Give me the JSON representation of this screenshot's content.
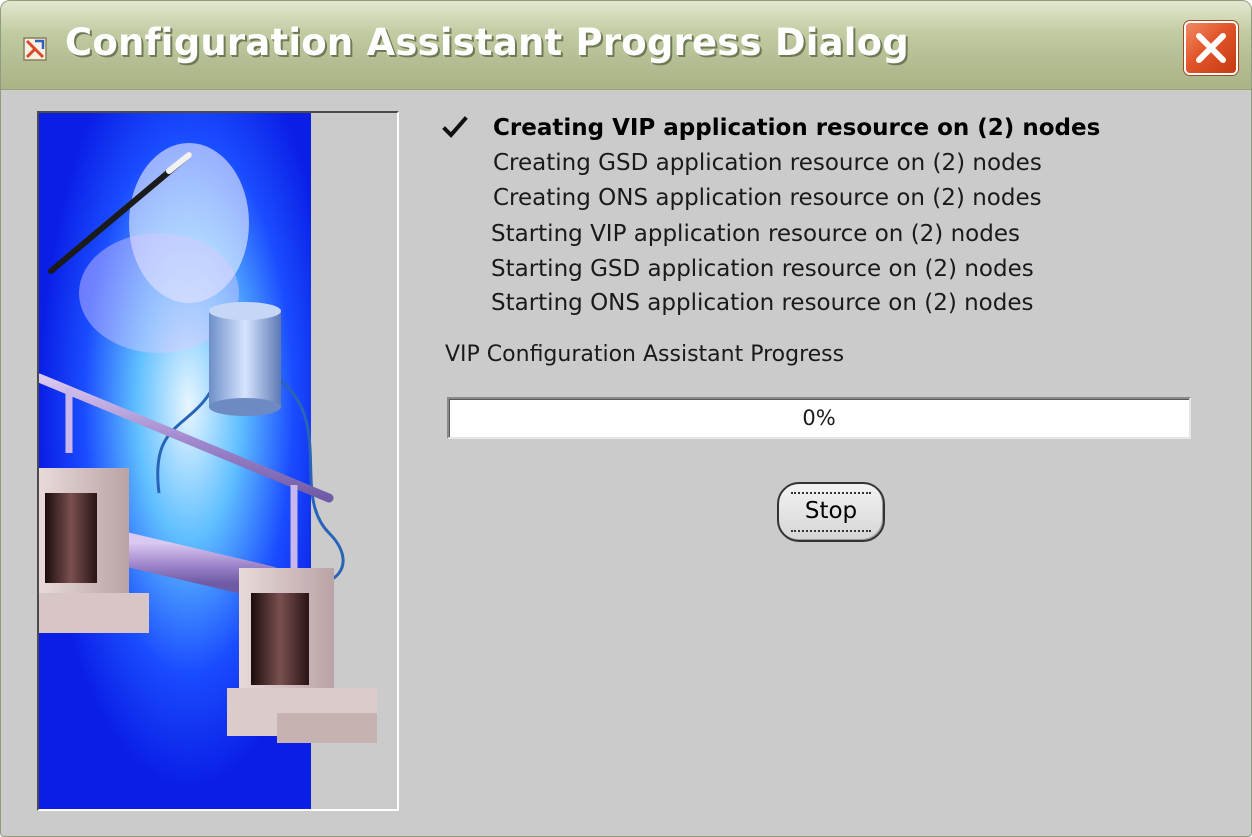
{
  "window": {
    "title": "Configuration Assistant Progress Dialog",
    "title_icon": "oracle-app-icon",
    "close_icon": "close-icon",
    "title_bar_color": "#b6c096",
    "close_button_color": "#e2552a"
  },
  "illustration": {
    "description_icon": "cluster-illustration-icon"
  },
  "steps": [
    {
      "label": "Creating VIP application resource on (2) nodes",
      "status": "current"
    },
    {
      "label": "Creating GSD application resource on (2) nodes",
      "status": "pending"
    },
    {
      "label": "Creating ONS application resource on (2) nodes",
      "status": "pending"
    },
    {
      "label": "Starting VIP application resource on (2) nodes",
      "status": "pending"
    },
    {
      "label": "Starting GSD application resource on (2) nodes",
      "status": "pending"
    },
    {
      "label": "Starting ONS application resource on (2) nodes",
      "status": "pending"
    }
  ],
  "progress": {
    "label": "VIP Configuration Assistant Progress",
    "value_text": "0%",
    "fraction": 0
  },
  "buttons": {
    "stop_label": "Stop"
  }
}
